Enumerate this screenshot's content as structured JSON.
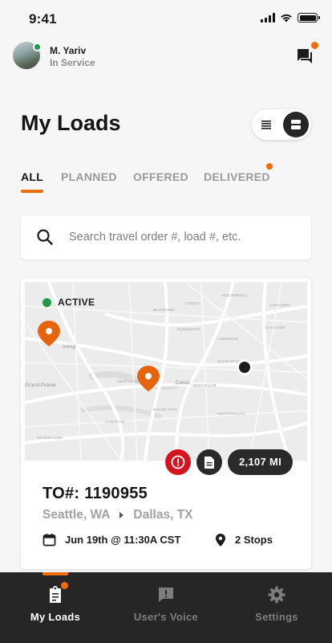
{
  "status_bar": {
    "time": "9:41",
    "icons": [
      "signal-icon",
      "wifi-icon",
      "battery-icon"
    ]
  },
  "header": {
    "user_name": "M. Yariv",
    "user_status": "In Service",
    "status_color": "#1e9a4b",
    "chat_icon": "chat-icon",
    "chat_has_notification": true
  },
  "page": {
    "title": "My Loads",
    "view_toggle": {
      "options": [
        "list-view-icon",
        "card-view-icon"
      ],
      "selected": "card-view-icon"
    }
  },
  "tabs": [
    {
      "label": "ALL",
      "active": true
    },
    {
      "label": "PLANNED",
      "active": false
    },
    {
      "label": "OFFERED",
      "active": false
    },
    {
      "label": "DELIVERED",
      "active": false,
      "has_notification": true
    }
  ],
  "search": {
    "placeholder": "Search travel order #, load #, etc.",
    "value": ""
  },
  "load": {
    "status": "ACTIVE",
    "status_color": "#1e9a4b",
    "map_labels": {
      "city_center": "Dallas",
      "city_west": "Irving",
      "area_sw": "Grand Prairie"
    },
    "distance": "2,107 MI",
    "order_number": "TO#: 1190955",
    "origin": "Seattle, WA",
    "destination": "Dallas, TX",
    "pickup": "Jun 19th @ 11:30A CST",
    "stops": "2 Stops"
  },
  "bottom_nav": [
    {
      "label": "My Loads",
      "icon": "loads-icon",
      "active": true,
      "has_notification": true
    },
    {
      "label": "User's Voice",
      "icon": "feedback-icon",
      "active": false
    },
    {
      "label": "Settings",
      "icon": "gear-icon",
      "active": false
    }
  ],
  "colors": {
    "accent": "#ef6c0a",
    "alert": "#d4141e",
    "dark": "#262626"
  }
}
